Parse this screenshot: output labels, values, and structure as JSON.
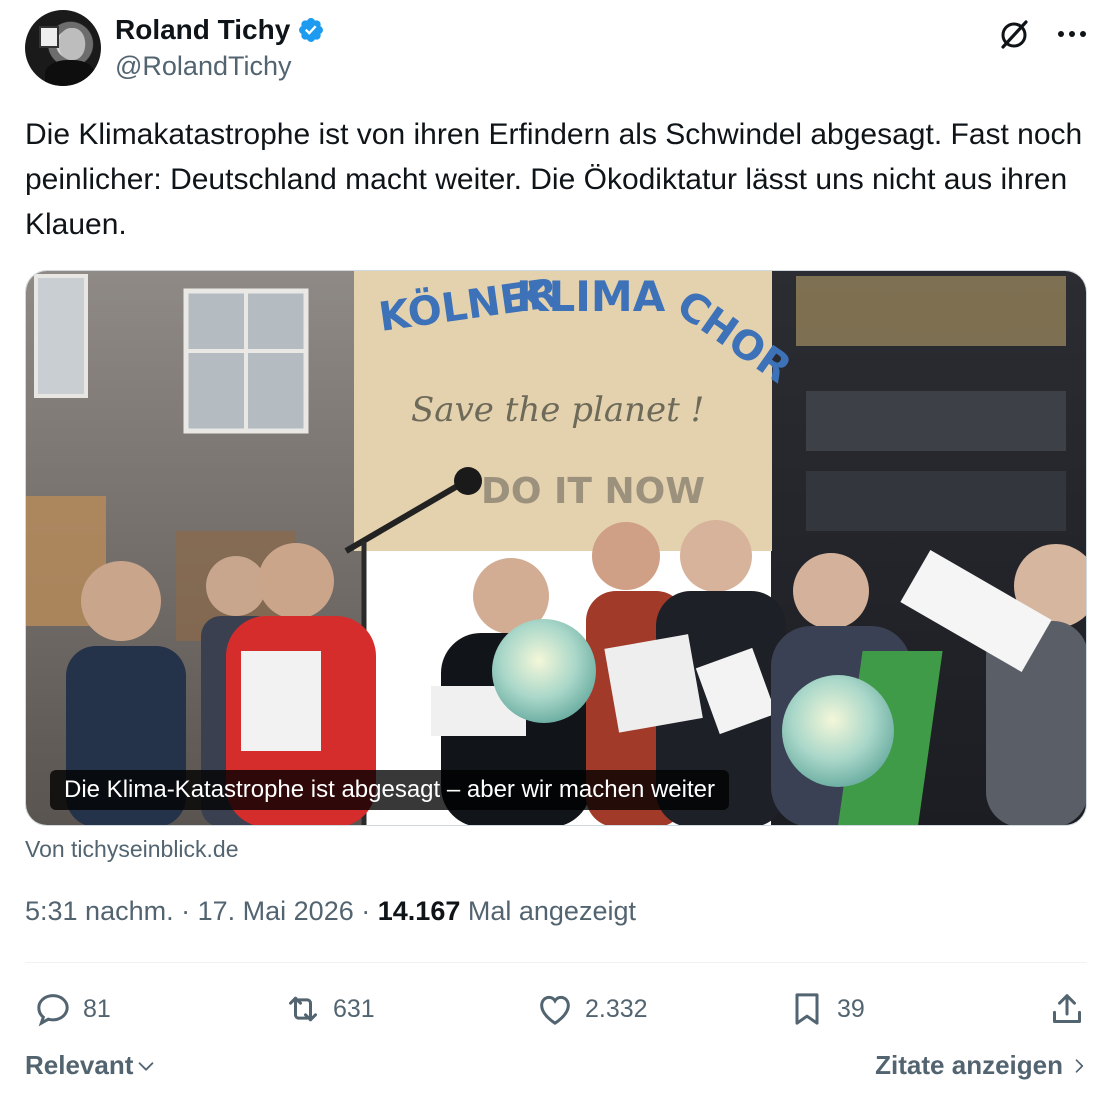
{
  "author": {
    "display_name": "Roland Tichy",
    "handle": "@RolandTichy",
    "verified": true,
    "avatar_icon": "profile-photo"
  },
  "toolbar": {
    "grok_icon": "grok-icon",
    "more_icon": "more-icon"
  },
  "tweet": {
    "text": "Die Klimakatastrophe ist von ihren Erfindern als Schwindel abgesagt. Fast noch peinlicher: Deutschland macht weiter. Die Ökodiktatur lässt uns nicht aus ihren Klauen."
  },
  "card": {
    "image_sign_text": {
      "line1": "KÖLNER KLIMA CHOR",
      "line2": "Save the planet !",
      "line3": "DO IT NOW"
    },
    "caption": "Die Klima-Katastrophe ist abgesagt – aber wir machen weiter",
    "source": "Von tichyseinblick.de"
  },
  "meta": {
    "time": "5:31 nachm.",
    "separator": "·",
    "date": "17. Mai 2026",
    "views_count": "14.167",
    "views_label": "Mal angezeigt"
  },
  "actions": {
    "replies": "81",
    "reposts": "631",
    "likes": "2.332",
    "bookmarks": "39"
  },
  "footer": {
    "sort_label": "Relevant",
    "quotes_label": "Zitate anzeigen"
  },
  "colors": {
    "text_primary": "#0f1419",
    "text_secondary": "#536471",
    "verified_blue": "#1d9bf0",
    "border": "#cfd9de"
  }
}
